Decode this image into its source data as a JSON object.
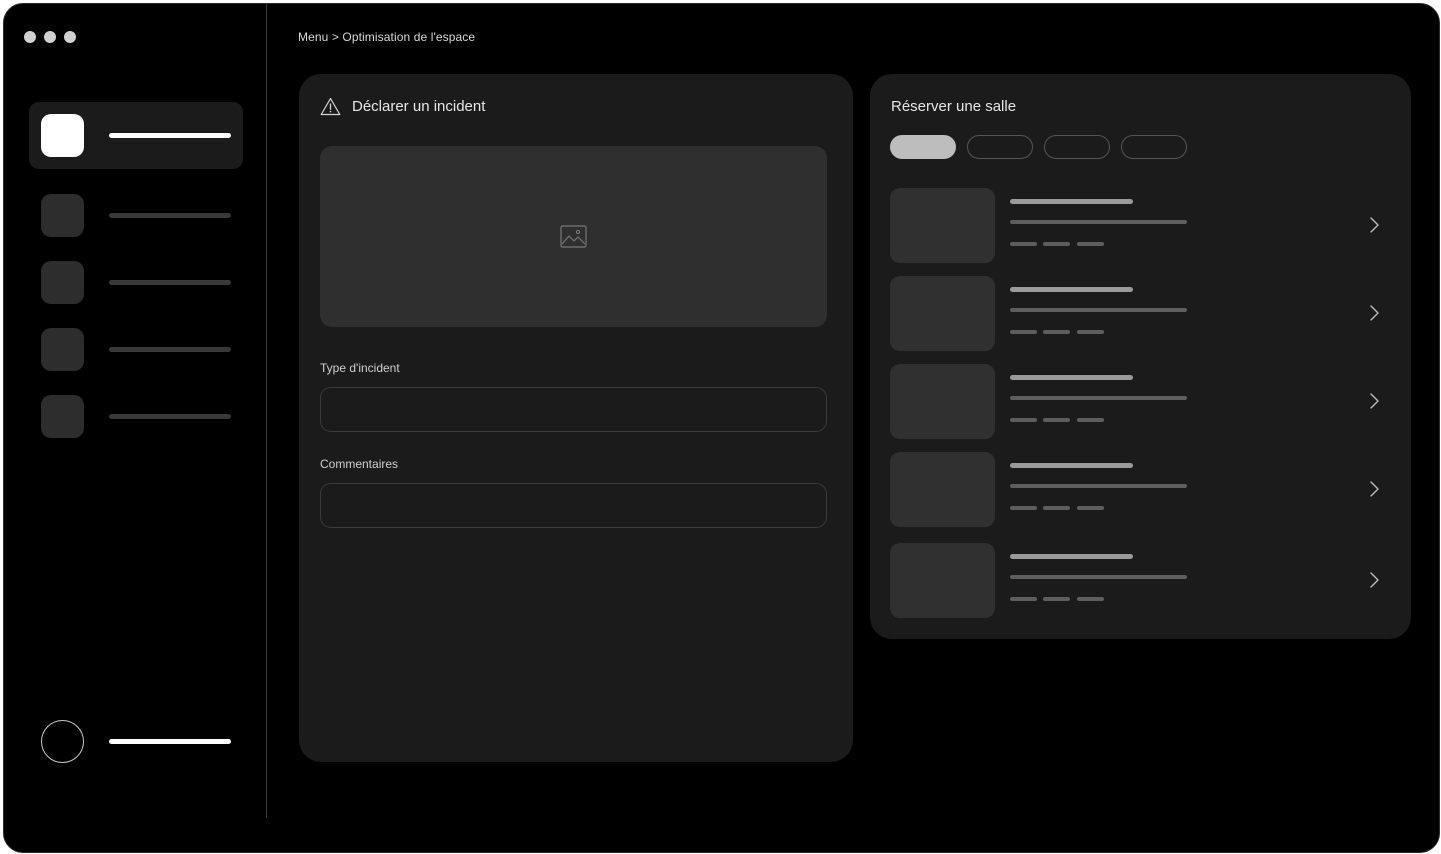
{
  "breadcrumb": "Menu > Optimisation de l'espace",
  "incident": {
    "title": "Déclarer un incident",
    "type_label": "Type d'incident",
    "type_value": "",
    "comments_label": "Commentaires",
    "comments_value": ""
  },
  "booking": {
    "title": "Réserver une salle",
    "filter_count": 4,
    "active_filter_index": 0,
    "rooms_count": 5
  },
  "sidebar": {
    "items_count": 5,
    "active_index": 0
  },
  "icons": {
    "window_controls": "traffic-light-dots",
    "incident": "warning-triangle-icon",
    "image_placeholder": "image-icon",
    "room_action": "chevron-right-icon",
    "profile": "avatar-circle"
  },
  "colors": {
    "background": "#000000",
    "card": "#1b1b1b",
    "placeholder": "#2f2f2f",
    "active": "#ffffff"
  }
}
